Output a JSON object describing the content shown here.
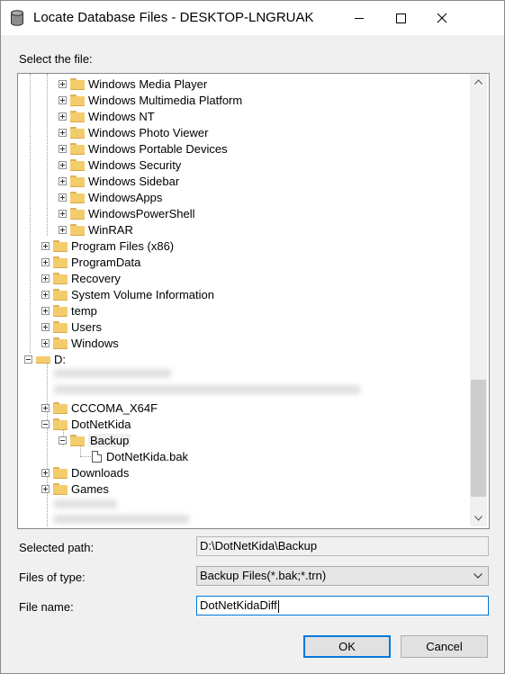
{
  "window": {
    "title": "Locate Database Files - DESKTOP-LNGRUAK"
  },
  "labels": {
    "select_file": "Select the file:",
    "selected_path": "Selected path:",
    "files_of_type": "Files of type:",
    "file_name": "File name:"
  },
  "tree": {
    "items": [
      {
        "label": "Windows Media Player"
      },
      {
        "label": "Windows Multimedia Platform"
      },
      {
        "label": "Windows NT"
      },
      {
        "label": "Windows Photo Viewer"
      },
      {
        "label": "Windows Portable Devices"
      },
      {
        "label": "Windows Security"
      },
      {
        "label": "Windows Sidebar"
      },
      {
        "label": "WindowsApps"
      },
      {
        "label": "WindowsPowerShell"
      },
      {
        "label": "WinRAR"
      },
      {
        "label": "Program Files (x86)"
      },
      {
        "label": "ProgramData"
      },
      {
        "label": "Recovery"
      },
      {
        "label": "System Volume Information"
      },
      {
        "label": "temp"
      },
      {
        "label": "Users"
      },
      {
        "label": "Windows"
      },
      {
        "label": "D:"
      },
      {
        "label": "CCCOMA_X64F"
      },
      {
        "label": "DotNetKida"
      },
      {
        "label": "Backup"
      },
      {
        "label": "DotNetKida.bak"
      },
      {
        "label": "Downloads"
      },
      {
        "label": "Games"
      }
    ]
  },
  "fields": {
    "selected_path": "D:\\DotNetKida\\Backup",
    "files_of_type": "Backup Files(*.bak;*.trn)",
    "file_name": "DotNetKidaDiff"
  },
  "buttons": {
    "ok": "OK",
    "cancel": "Cancel"
  }
}
